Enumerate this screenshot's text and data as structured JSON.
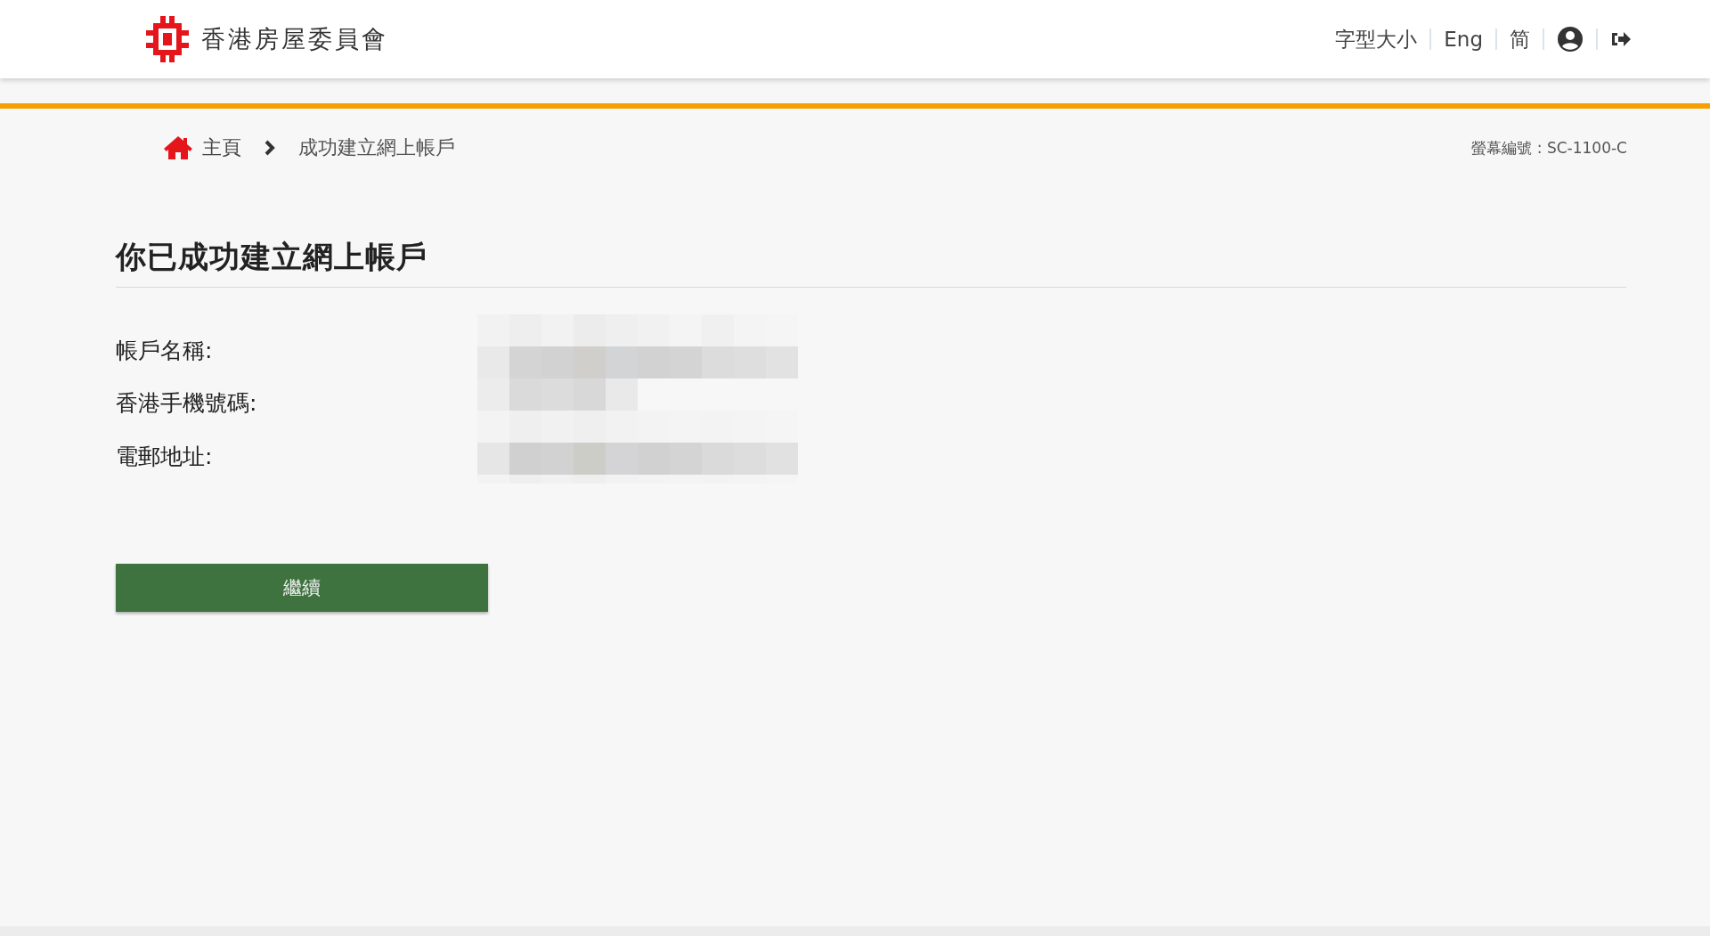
{
  "header": {
    "logo_text": "香港房屋委員會",
    "links": [
      {
        "label": "字型大小"
      },
      {
        "label": "Eng"
      },
      {
        "label": "简"
      }
    ]
  },
  "breadcrumb": {
    "home": "主頁",
    "current": "成功建立網上帳戶"
  },
  "screen_id": "螢幕編號 : SC-1100-C",
  "title": "你已成功建立網上帳戶",
  "fields": [
    {
      "label": "帳戶名稱:"
    },
    {
      "label": "香港手機號碼:"
    },
    {
      "label": "電郵地址:"
    }
  ],
  "button": "繼續"
}
